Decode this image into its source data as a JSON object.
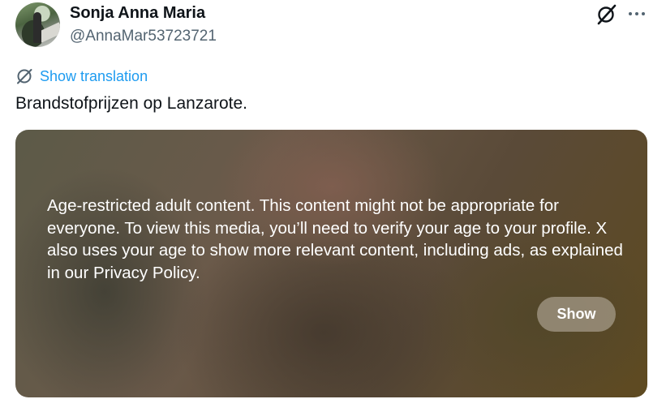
{
  "author": {
    "display_name": "Sonja Anna Maria",
    "handle": "@AnnaMar53723721",
    "avatar_icon": "user-avatar"
  },
  "header_icons": {
    "grok": "grok-icon",
    "more": "more-options-icon"
  },
  "translation": {
    "icon": "translate-icon",
    "label": "Show translation"
  },
  "tweet": {
    "text": "Brandstofprijzen op Lanzarote."
  },
  "media": {
    "warning_text": "Age-restricted adult content. This content might not be appropriate for everyone. To view this media, you’ll need to verify your age to your profile. X also uses your age to show more relevant content, including ads, as explained in our Privacy Policy.",
    "show_button_label": "Show"
  },
  "colors": {
    "link": "#1d9bf0",
    "text_primary": "#0f1419",
    "text_secondary": "#536471"
  }
}
